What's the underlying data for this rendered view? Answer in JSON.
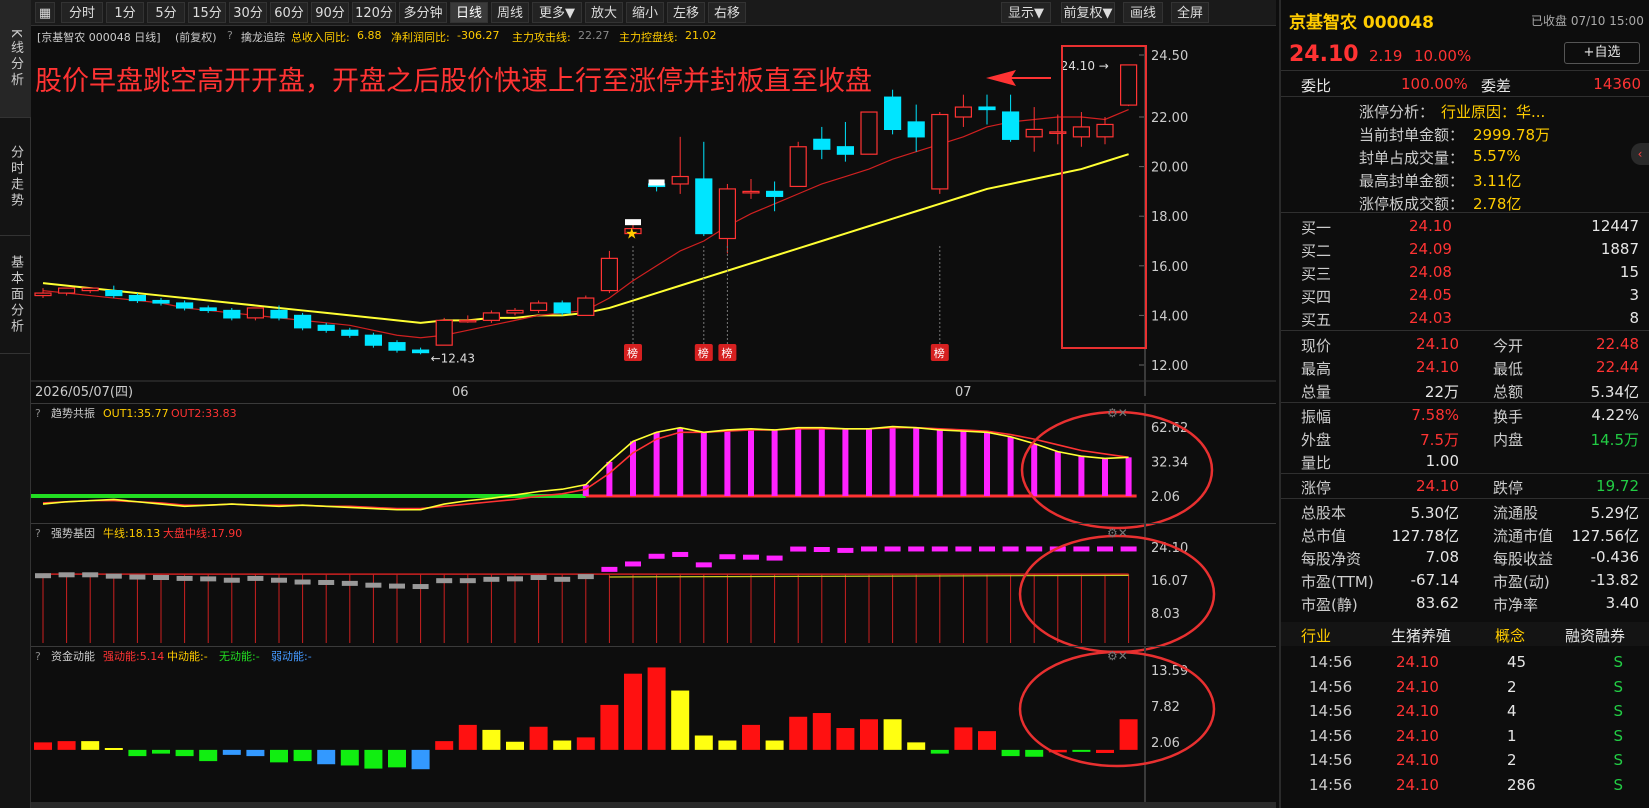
{
  "left_tabs": [
    "K线分析",
    "分时走势",
    "基本面分析"
  ],
  "toolbar": {
    "items": [
      "分时",
      "1分",
      "5分",
      "15分",
      "30分",
      "60分",
      "90分",
      "120分",
      "多分钟",
      "日线",
      "周线",
      "更多▼",
      "放大",
      "缩小",
      "左移",
      "右移"
    ],
    "active": "日线",
    "right_items": [
      "显示▼",
      "前复权▼",
      "画线",
      "全屏"
    ]
  },
  "header": {
    "stock_label": "[京基智农 000048 日线]",
    "adj": "(前复权)",
    "help": "?",
    "tool": "擒龙追踪",
    "stats": [
      {
        "label": "总收入同比:",
        "value": "6.88",
        "color": "#ffcc00"
      },
      {
        "label": "净利润同比:",
        "value": "-306.27",
        "color": "#ffcc00"
      },
      {
        "label": "主力攻击线:",
        "value": "22.27",
        "color": "#888888"
      },
      {
        "label": "主力控盘线:",
        "value": "21.02",
        "color": "#ffcc00"
      }
    ]
  },
  "annotation": "股价早盘跳空高开开盘，开盘之后股价快速上行至涨停并封板直至收盘",
  "chart_data": {
    "type": "candlestick",
    "price_axis": {
      "ticks": [
        24.5,
        22.0,
        20.0,
        18.0,
        16.0,
        14.0,
        12.0
      ],
      "labels": [
        "24.50",
        "22.00",
        "20.00",
        "18.00",
        "16.00",
        "14.00",
        "12.00"
      ]
    },
    "x_labels": [
      "2026/05/07(四)",
      "06",
      "07"
    ],
    "low_marker": "12.43",
    "high_marker": "24.10",
    "bang_label": "榜",
    "candles": [
      [
        14.8,
        15.1,
        14.9,
        14.7
      ],
      [
        14.9,
        15.0,
        15.1,
        14.8
      ],
      [
        15.0,
        15.1,
        15.1,
        14.9
      ],
      [
        15.0,
        15.2,
        14.8,
        14.7
      ],
      [
        14.8,
        14.9,
        14.6,
        14.5
      ],
      [
        14.6,
        14.7,
        14.5,
        14.4
      ],
      [
        14.5,
        14.6,
        14.3,
        14.2
      ],
      [
        14.3,
        14.4,
        14.2,
        14.1
      ],
      [
        14.2,
        14.3,
        13.9,
        13.8
      ],
      [
        13.9,
        14.3,
        14.3,
        13.8
      ],
      [
        14.2,
        14.4,
        13.9,
        13.8
      ],
      [
        14.0,
        14.1,
        13.5,
        13.4
      ],
      [
        13.6,
        13.7,
        13.4,
        13.3
      ],
      [
        13.4,
        13.5,
        13.2,
        13.1
      ],
      [
        13.2,
        13.3,
        12.8,
        12.7
      ],
      [
        12.9,
        13.0,
        12.6,
        12.5
      ],
      [
        12.6,
        12.7,
        12.5,
        12.43
      ],
      [
        12.8,
        13.9,
        13.8,
        12.8
      ],
      [
        13.8,
        14.0,
        13.8,
        13.7
      ],
      [
        13.8,
        14.2,
        14.1,
        13.7
      ],
      [
        14.1,
        14.3,
        14.2,
        14.0
      ],
      [
        14.2,
        14.6,
        14.5,
        14.1
      ],
      [
        14.5,
        14.6,
        14.1,
        14.0
      ],
      [
        14.0,
        14.8,
        14.7,
        14.0
      ],
      [
        15.0,
        16.6,
        16.3,
        14.9
      ],
      [
        17.3,
        17.8,
        17.5,
        17.3
      ],
      [
        19.3,
        19.4,
        19.2,
        19.0
      ],
      [
        19.3,
        21.2,
        19.6,
        18.9
      ],
      [
        19.5,
        21.0,
        17.3,
        17.2
      ],
      [
        17.1,
        19.3,
        19.1,
        16.5
      ],
      [
        19.0,
        19.5,
        19.0,
        18.7
      ],
      [
        19.0,
        19.4,
        18.8,
        18.2
      ],
      [
        19.2,
        21.0,
        20.8,
        19.3
      ],
      [
        21.1,
        21.6,
        20.7,
        20.3
      ],
      [
        20.8,
        21.8,
        20.5,
        20.2
      ],
      [
        20.5,
        22.2,
        22.2,
        20.5
      ],
      [
        22.8,
        23.1,
        21.5,
        21.3
      ],
      [
        21.8,
        22.5,
        21.2,
        20.6
      ],
      [
        19.1,
        22.2,
        22.1,
        18.9
      ],
      [
        22.0,
        22.9,
        22.4,
        21.6
      ],
      [
        22.4,
        22.9,
        22.3,
        21.7
      ],
      [
        22.2,
        22.9,
        21.1,
        21.0
      ],
      [
        21.2,
        22.4,
        21.5,
        20.6
      ],
      [
        21.4,
        22.1,
        21.4,
        20.9
      ],
      [
        21.2,
        22.2,
        21.6,
        20.8
      ],
      [
        21.2,
        22.0,
        21.7,
        20.9
      ],
      [
        22.48,
        24.1,
        24.1,
        22.44
      ]
    ],
    "ma_red": [
      15.0,
      14.9,
      14.8,
      14.7,
      14.6,
      14.5,
      14.3,
      14.2,
      14.1,
      14.0,
      13.9,
      13.8,
      13.7,
      13.6,
      13.4,
      13.2,
      13.1,
      13.2,
      13.4,
      13.6,
      13.8,
      14.0,
      14.1,
      14.2,
      14.7,
      15.4,
      16.0,
      16.6,
      17.0,
      17.6,
      18.1,
      18.5,
      18.9,
      19.3,
      19.6,
      19.9,
      20.3,
      20.6,
      20.9,
      21.2,
      21.6,
      21.8,
      21.9,
      22.0,
      22.0,
      21.9,
      22.3
    ],
    "ma_yellow": [
      15.3,
      15.2,
      15.1,
      15.0,
      14.9,
      14.8,
      14.7,
      14.6,
      14.5,
      14.4,
      14.3,
      14.2,
      14.1,
      14.0,
      13.9,
      13.8,
      13.7,
      13.8,
      13.8,
      13.9,
      13.9,
      14.0,
      14.0,
      14.1,
      14.3,
      14.6,
      14.9,
      15.2,
      15.5,
      15.8,
      16.1,
      16.4,
      16.7,
      17.0,
      17.3,
      17.6,
      17.9,
      18.2,
      18.5,
      18.8,
      19.1,
      19.3,
      19.5,
      19.7,
      19.9,
      20.2,
      20.5
    ],
    "trend": {
      "title": "趋势共振",
      "out1_label": "OUT1:",
      "out1": "35.77",
      "out2_label": "OUT2:",
      "out2": "33.83",
      "ticks": [
        62.62,
        32.34,
        2.06
      ],
      "labels": [
        "62.62",
        "32.34",
        "2.06"
      ],
      "out1_series": [
        -5,
        -3,
        -2,
        -1,
        -3,
        -5,
        -7,
        -6,
        -5,
        -6,
        -7,
        -6,
        -7,
        -8,
        -9,
        -10,
        -10,
        -5,
        -2,
        0,
        3,
        6,
        8,
        12,
        32,
        50,
        58,
        62,
        58,
        60,
        61,
        60,
        62,
        62,
        61,
        61,
        63,
        62,
        60,
        59,
        58,
        54,
        48,
        41,
        37,
        35,
        36
      ],
      "out2_series": [
        -4,
        -3,
        -2,
        -2,
        -3,
        -4,
        -6,
        -6,
        -5,
        -6,
        -6,
        -6,
        -7,
        -7,
        -8,
        -9,
        -9,
        -7,
        -5,
        -3,
        -1,
        2,
        4,
        8,
        22,
        40,
        52,
        58,
        58,
        59,
        60,
        60,
        61,
        61,
        61,
        61,
        62,
        62,
        61,
        60,
        59,
        56,
        52,
        47,
        42,
        39,
        36
      ]
    },
    "strength": {
      "title": "强势基因",
      "bull_label": "牛线:",
      "bull": "18.13",
      "mid_label": "大盘中线:",
      "mid": "17.90",
      "ticks": [
        24.1,
        16.07,
        8.03
      ],
      "labels": [
        "24.10",
        "16.07",
        "8.03"
      ]
    },
    "money": {
      "title": "资金动能",
      "strong_label": "强动能:",
      "strong": "5.14",
      "mid_label": "中动能:",
      "mid": "-",
      "none_label": "无动能:",
      "none": "-",
      "weak_label": "弱动能:",
      "weak": "-",
      "ticks": [
        13.59,
        7.82,
        2.06
      ],
      "labels": [
        "13.59",
        "7.82",
        "2.06"
      ],
      "bars": [
        1.2,
        1.4,
        1.4,
        0.3,
        -1.0,
        -0.6,
        -1.0,
        -1.8,
        -0.8,
        -1.0,
        -2.0,
        -1.8,
        -2.3,
        -2.5,
        -3.0,
        -2.8,
        -3.1,
        1.4,
        4.0,
        3.2,
        1.3,
        3.7,
        1.5,
        2.0,
        7.2,
        12.2,
        13.2,
        9.5,
        2.3,
        1.5,
        4.0,
        1.5,
        5.3,
        5.9,
        3.5,
        4.9,
        4.9,
        1.2,
        -0.6,
        3.6,
        3.0,
        -1.0,
        -1.1,
        -0.4,
        -0.2,
        -0.5,
        4.9
      ],
      "colors": [
        "r",
        "r",
        "y",
        "y",
        "g",
        "g",
        "g",
        "g",
        "b",
        "b",
        "g",
        "g",
        "b",
        "g",
        "g",
        "g",
        "b",
        "r",
        "r",
        "y",
        "y",
        "r",
        "y",
        "r",
        "r",
        "r",
        "r",
        "y",
        "y",
        "y",
        "r",
        "y",
        "r",
        "r",
        "r",
        "r",
        "y",
        "y",
        "g",
        "r",
        "r",
        "g",
        "g",
        "r",
        "g",
        "r",
        "r"
      ]
    }
  },
  "right": {
    "name": "京基智农",
    "code": "000048",
    "status": "已收盘",
    "time": "07/10 15:00",
    "price": "24.10",
    "change": "2.19",
    "pct": "10.00%",
    "watch": "+自选",
    "ratio_label": "委比",
    "ratio": "100.00%",
    "diff_label": "委差",
    "diff": "14360",
    "limit": [
      {
        "l": "涨停分析：",
        "v": "行业原因：华..."
      },
      {
        "l": "当前封单金额：",
        "v": "2999.78万"
      },
      {
        "l": "封单占成交量：",
        "v": "5.57%"
      },
      {
        "l": "最高封单金额：",
        "v": "3.11亿"
      },
      {
        "l": "涨停板成交额：",
        "v": "2.78亿"
      }
    ],
    "bids": [
      {
        "l": "买一",
        "p": "24.10",
        "v": "12447"
      },
      {
        "l": "买二",
        "p": "24.09",
        "v": "1887"
      },
      {
        "l": "买三",
        "p": "24.08",
        "v": "15"
      },
      {
        "l": "买四",
        "p": "24.05",
        "v": "3"
      },
      {
        "l": "买五",
        "p": "24.03",
        "v": "8"
      }
    ],
    "quote": [
      {
        "l1": "现价",
        "v1": "24.10",
        "c1": "red",
        "l2": "今开",
        "v2": "22.48",
        "c2": "red"
      },
      {
        "l1": "最高",
        "v1": "24.10",
        "c1": "red",
        "l2": "最低",
        "v2": "22.44",
        "c2": "red"
      },
      {
        "l1": "总量",
        "v1": "22万",
        "c1": "wht",
        "l2": "总额",
        "v2": "5.34亿",
        "c2": "wht"
      },
      {
        "l1": "振幅",
        "v1": "7.58%",
        "c1": "red",
        "l2": "换手",
        "v2": "4.22%",
        "c2": "wht"
      },
      {
        "l1": "外盘",
        "v1": "7.5万",
        "c1": "red",
        "l2": "内盘",
        "v2": "14.5万",
        "c2": "grn"
      },
      {
        "l1": "量比",
        "v1": "1.00",
        "c1": "wht",
        "l2": "",
        "v2": "",
        "c2": "wht"
      },
      {
        "l1": "涨停",
        "v1": "24.10",
        "c1": "red",
        "l2": "跌停",
        "v2": "19.72",
        "c2": "grn"
      },
      {
        "l1": "总股本",
        "v1": "5.30亿",
        "c1": "wht",
        "l2": "流通股",
        "v2": "5.29亿",
        "c2": "wht"
      },
      {
        "l1": "总市值",
        "v1": "127.78亿",
        "c1": "wht",
        "l2": "流通市值",
        "v2": "127.56亿",
        "c2": "wht"
      },
      {
        "l1": "每股净资",
        "v1": "7.08",
        "c1": "wht",
        "l2": "每股收益",
        "v2": "-0.436",
        "c2": "wht"
      },
      {
        "l1": "市盈(TTM)",
        "v1": "-67.14",
        "c1": "wht",
        "l2": "市盈(动)",
        "v2": "-13.82",
        "c2": "wht"
      },
      {
        "l1": "市盈(静)",
        "v1": "83.62",
        "c1": "wht",
        "l2": "市净率",
        "v2": "3.40",
        "c2": "wht"
      }
    ],
    "tabs": [
      "行业",
      "生猪养殖",
      "概念",
      "融资融券"
    ],
    "trades": [
      {
        "t": "14:56",
        "p": "24.10",
        "v": "45",
        "s": "S"
      },
      {
        "t": "14:56",
        "p": "24.10",
        "v": "2",
        "s": "S"
      },
      {
        "t": "14:56",
        "p": "24.10",
        "v": "4",
        "s": "S"
      },
      {
        "t": "14:56",
        "p": "24.10",
        "v": "1",
        "s": "S"
      },
      {
        "t": "14:56",
        "p": "24.10",
        "v": "2",
        "s": "S"
      },
      {
        "t": "14:56",
        "p": "24.10",
        "v": "286",
        "s": "S"
      }
    ],
    "colors": {
      "up": "#ff3333",
      "down": "#22cc44",
      "price": "#ff3333"
    }
  }
}
